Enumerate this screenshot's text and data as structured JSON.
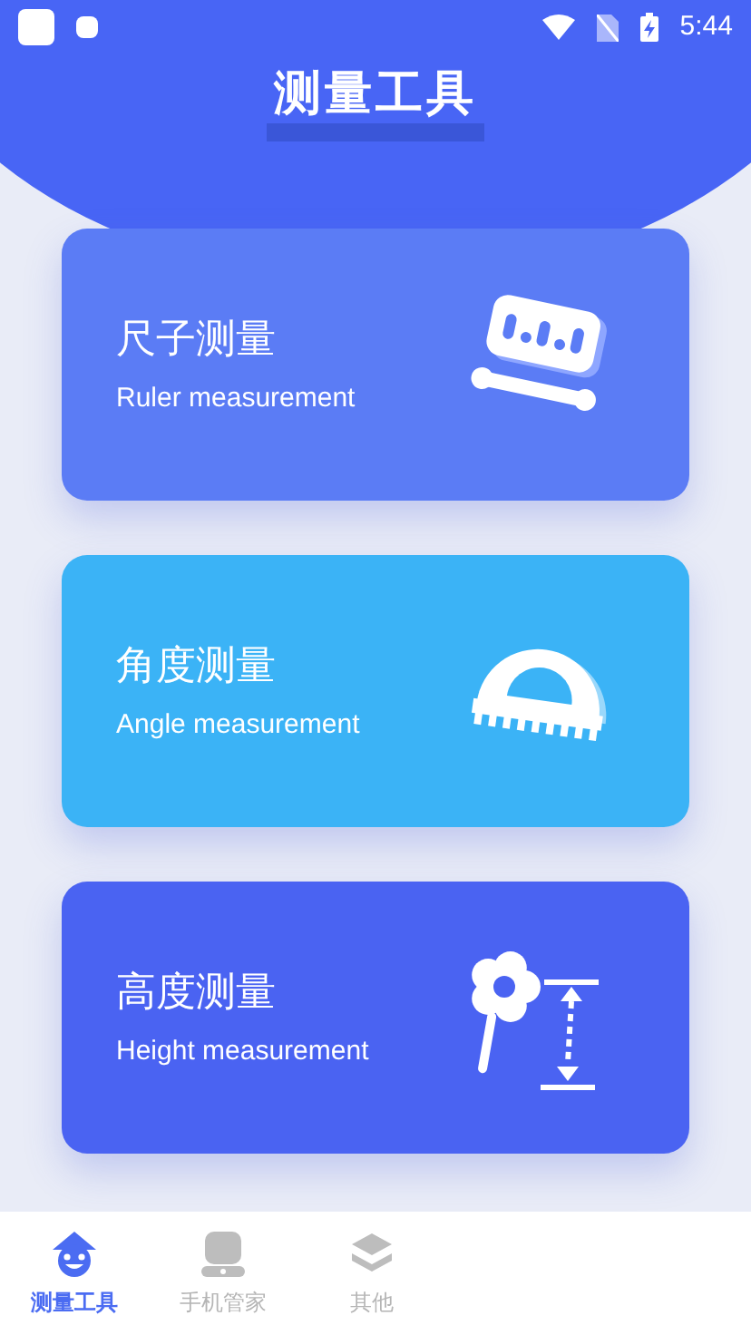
{
  "status_bar": {
    "time": "5:44"
  },
  "title": "测量工具",
  "cards": [
    {
      "kind": "ruler",
      "title": "尺子测量",
      "subtitle": "Ruler measurement",
      "color": "#5b7cf5"
    },
    {
      "kind": "angle",
      "title": "角度测量",
      "subtitle": "Angle measurement",
      "color": "#3bb3f6"
    },
    {
      "kind": "height",
      "title": "高度测量",
      "subtitle": "Height measurement",
      "color": "#4a63f2"
    }
  ],
  "tabs": [
    {
      "kind": "measure",
      "label": "测量工具",
      "selected": true
    },
    {
      "kind": "phone",
      "label": "手机管家",
      "selected": false
    },
    {
      "kind": "other",
      "label": "其他",
      "selected": false
    }
  ]
}
